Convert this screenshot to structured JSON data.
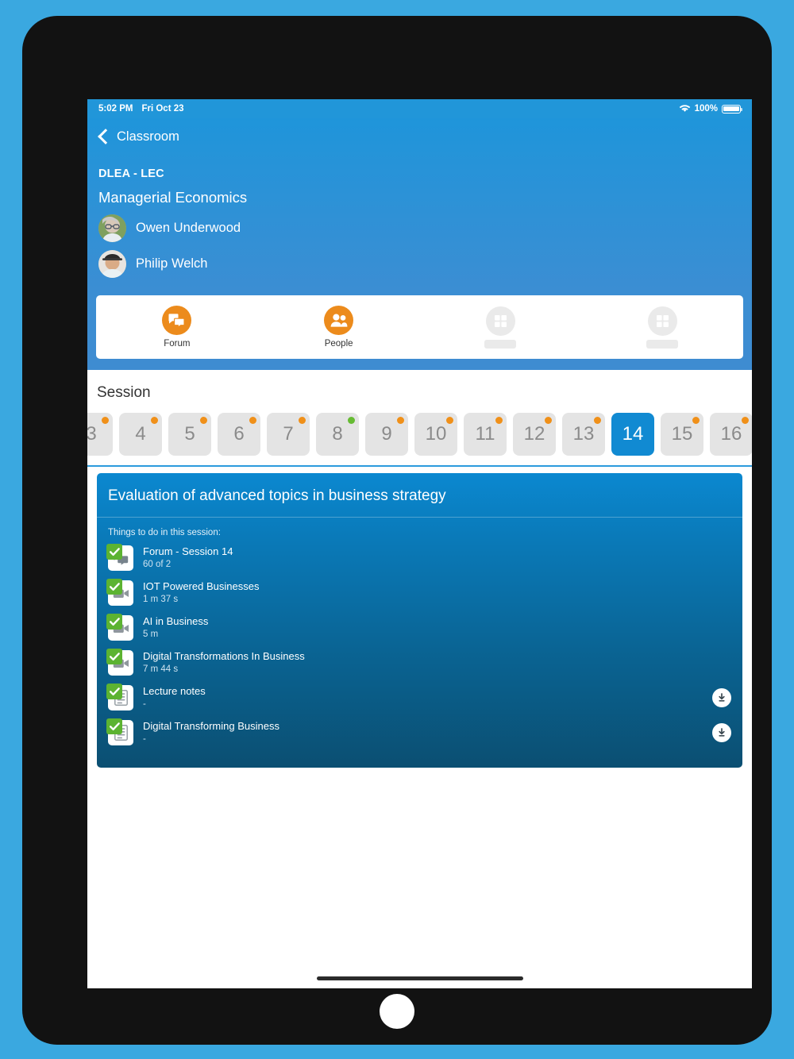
{
  "status_bar": {
    "time": "5:02 PM",
    "date": "Fri Oct 23",
    "wifi_icon": "wifi-icon",
    "battery_percent": "100%",
    "battery_icon": "battery-full-icon"
  },
  "header": {
    "back_icon": "chevron-left-icon",
    "back_label": "Classroom",
    "course_code": "DLEA - LEC",
    "course_title": "Managerial Economics",
    "teachers": [
      {
        "name": "Owen Underwood",
        "avatar": "avatar-owen-underwood"
      },
      {
        "name": "Philip Welch",
        "avatar": "avatar-philip-welch"
      }
    ]
  },
  "tabbar": {
    "accent_color": "#ec8b1c",
    "items": [
      {
        "label": "Forum",
        "icon": "forum-chat-icon",
        "state": "loaded"
      },
      {
        "label": "People",
        "icon": "people-group-icon",
        "state": "loaded"
      },
      {
        "label": "",
        "icon": "placeholder-grid-icon",
        "state": "loading"
      },
      {
        "label": "",
        "icon": "placeholder-grid-icon",
        "state": "loading"
      }
    ]
  },
  "session_panel": {
    "title": "Session",
    "selected_session": "14",
    "dot_colors": {
      "pending": "#f09019",
      "complete": "#66bb33"
    },
    "selected_color": "#118ad2",
    "chips": [
      {
        "label": "3",
        "dot": "pending",
        "selected": false,
        "partial": true
      },
      {
        "label": "4",
        "dot": "pending",
        "selected": false
      },
      {
        "label": "5",
        "dot": "pending",
        "selected": false
      },
      {
        "label": "6",
        "dot": "pending",
        "selected": false
      },
      {
        "label": "7",
        "dot": "pending",
        "selected": false
      },
      {
        "label": "8",
        "dot": "complete",
        "selected": false
      },
      {
        "label": "9",
        "dot": "pending",
        "selected": false
      },
      {
        "label": "10",
        "dot": "pending",
        "selected": false
      },
      {
        "label": "11",
        "dot": "pending",
        "selected": false
      },
      {
        "label": "12",
        "dot": "pending",
        "selected": false
      },
      {
        "label": "13",
        "dot": "pending",
        "selected": false
      },
      {
        "label": "14",
        "dot": "none",
        "selected": true
      },
      {
        "label": "15",
        "dot": "pending",
        "selected": false
      },
      {
        "label": "16",
        "dot": "pending",
        "selected": false
      }
    ]
  },
  "content_card": {
    "title": "Evaluation of advanced topics in business strategy",
    "subtitle": "Things to do in this session:",
    "gradient_from": "#0b88d0",
    "gradient_to": "#0b4f72",
    "items": [
      {
        "name": "Forum - Session 14",
        "meta": "60 of 2",
        "icon": "forum-chat-icon",
        "checked": true,
        "download": false
      },
      {
        "name": "IOT Powered Businesses",
        "meta": "1 m 37 s",
        "icon": "video-camera-icon",
        "checked": true,
        "download": false
      },
      {
        "name": "AI in Business",
        "meta": "5 m",
        "icon": "video-camera-icon",
        "checked": true,
        "download": false
      },
      {
        "name": "Digital Transformations In Business",
        "meta": "7 m 44 s",
        "icon": "video-camera-icon",
        "checked": true,
        "download": false
      },
      {
        "name": "Lecture notes",
        "meta": "-",
        "icon": "document-icon",
        "checked": true,
        "download": true
      },
      {
        "name": "Digital Transforming Business",
        "meta": "-",
        "icon": "document-icon",
        "checked": true,
        "download": true
      }
    ]
  }
}
